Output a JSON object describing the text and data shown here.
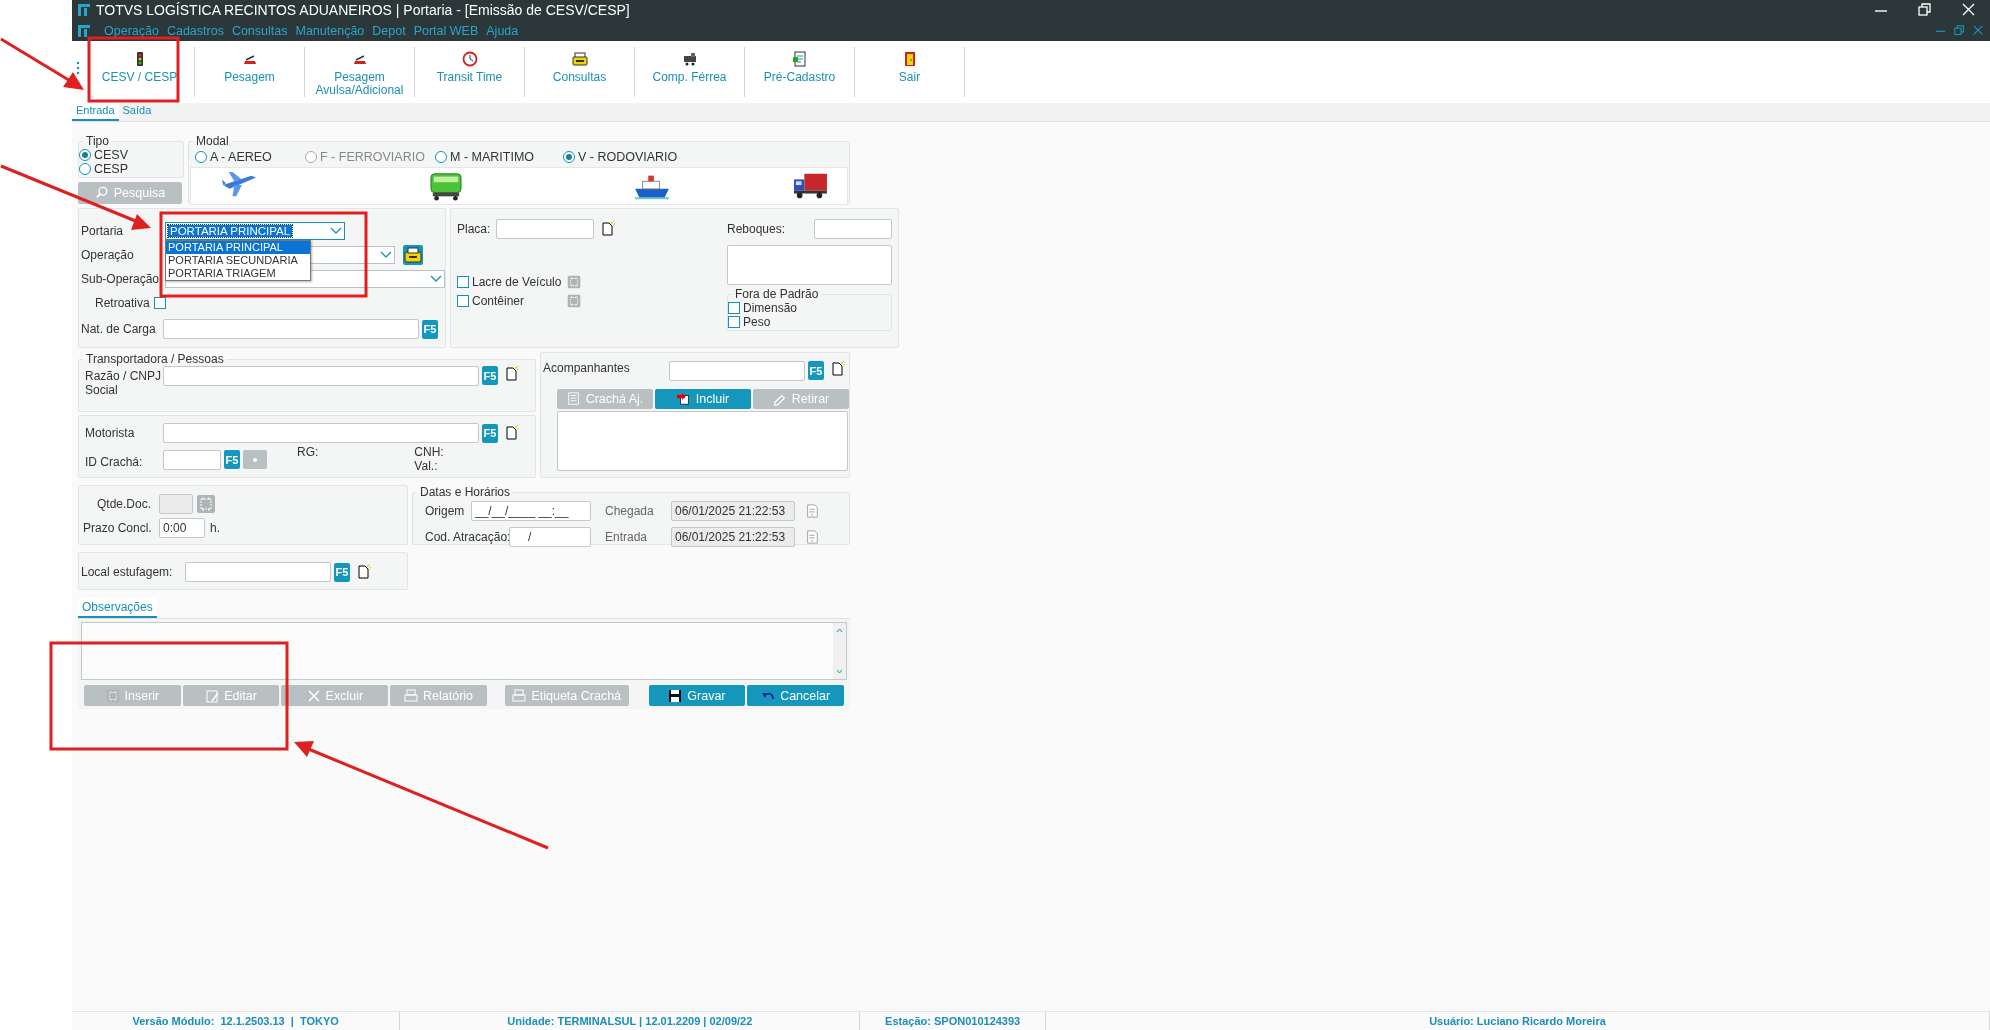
{
  "window": {
    "title": "TOTVS LOGÍSTICA RECINTOS ADUANEIROS | Portaria - [Emissão de CESV/CESP]"
  },
  "menu": [
    "Operação",
    "Cadastros",
    "Consultas",
    "Manutenção",
    "Depot",
    "Portal WEB",
    "Ajuda"
  ],
  "toolbar": [
    {
      "label": "CESV / CESP"
    },
    {
      "label": "Pesagem"
    },
    {
      "label": "Pesagem Avulsa/Adicional"
    },
    {
      "label": "Transit Time"
    },
    {
      "label": "Consultas"
    },
    {
      "label": "Comp. Férrea"
    },
    {
      "label": "Pré-Cadastro"
    },
    {
      "label": "Sair"
    }
  ],
  "tabs": [
    {
      "label": "Entrada",
      "selected": true
    },
    {
      "label": "Saída",
      "selected": false
    }
  ],
  "tipo": {
    "title": "Tipo",
    "options": [
      {
        "label": "CESV",
        "selected": true
      },
      {
        "label": "CESP",
        "selected": false
      }
    ]
  },
  "search_button": {
    "label": "Pesquisa",
    "disabled": true
  },
  "modal": {
    "title": "Modal",
    "options": [
      {
        "label": "A - AEREO",
        "selected": false,
        "disabled": false
      },
      {
        "label": "F - FERROVIARIO",
        "selected": false,
        "disabled": true
      },
      {
        "label": "M - MARITIMO",
        "selected": false,
        "disabled": false
      },
      {
        "label": "V - RODOVIARIO",
        "selected": true,
        "disabled": false
      }
    ]
  },
  "portaria": {
    "label": "Portaria",
    "value": "PORTARIA PRINCIPAL",
    "expanded": true,
    "options": [
      {
        "label": "PORTARIA PRINCIPAL",
        "selected": true
      },
      {
        "label": "PORTARIA SECUNDARIA",
        "selected": false
      },
      {
        "label": "PORTARIA TRIAGEM",
        "selected": false
      }
    ]
  },
  "operacao": {
    "label": "Operação"
  },
  "sub_operacao": {
    "label": "Sub-Operação"
  },
  "retroativa": {
    "label": "Retroativa",
    "checked": false
  },
  "nat_carga": {
    "label": "Nat. de Carga",
    "key": "F5"
  },
  "placa": {
    "label": "Placa:"
  },
  "reboques": {
    "label": "Reboques:"
  },
  "vehicle_checks": [
    {
      "label": "Lacre de Veículo",
      "checked": false
    },
    {
      "label": "Contêiner",
      "checked": false
    }
  ],
  "fora_padrao": {
    "title": "Fora de Padrão",
    "options": [
      {
        "label": "Dimensão",
        "checked": false
      },
      {
        "label": "Peso",
        "checked": false
      }
    ]
  },
  "transportadora": {
    "title": "Transportadora / Pessoas",
    "label": "Razão / CNPJ Social",
    "key": "F5"
  },
  "motorista": {
    "label": "Motorista",
    "key": "F5",
    "id_label": "ID Crachá:",
    "id_key": "F5",
    "rg": "RG:",
    "cnh": "CNH:",
    "val": "Val.:"
  },
  "acompanhantes": {
    "label": "Acompanhantes",
    "key": "F5",
    "buttons": [
      {
        "label": "Crachá Aj.",
        "disabled": true
      },
      {
        "label": "Incluir",
        "disabled": false
      },
      {
        "label": "Retirar",
        "disabled": true
      }
    ]
  },
  "documentos": {
    "qtde_label": "Qtde.Doc.",
    "prazo_label": "Prazo Concl.",
    "prazo_value": "0:00",
    "prazo_unit": "h."
  },
  "datas": {
    "title": "Datas e Horários",
    "origem_label": "Origem",
    "origem_value": "__/__/____ __:__",
    "atracacao_label": "Cod. Atracação:",
    "atracacao_value": "/",
    "chegada_label": "Chegada",
    "chegada_value": "06/01/2025 21:22:53",
    "entrada_label": "Entrada",
    "entrada_value": "06/01/2025 21:22:53"
  },
  "local_estufagem": {
    "label": "Local estufagem:",
    "key": "F5"
  },
  "observacoes": {
    "tab": "Observações"
  },
  "actions": [
    {
      "label": "Inserir",
      "disabled": true
    },
    {
      "label": "Editar",
      "disabled": true
    },
    {
      "label": "Excluir",
      "disabled": true
    },
    {
      "label": "Relatório",
      "disabled": true
    },
    {
      "label": "Etiqueta Crachá",
      "disabled": true
    },
    {
      "label": "Gravar",
      "disabled": false
    },
    {
      "label": "Cancelar",
      "disabled": false
    }
  ],
  "status_bar": [
    "Versão Módulo:  12.1.2503.13  |  TOKYO",
    "Unidade: TERMINALSUL | 12.01.2209 | 02/09/22",
    "Estação: SPON010124393",
    "Usuário: Luciano Ricardo Moreira"
  ]
}
